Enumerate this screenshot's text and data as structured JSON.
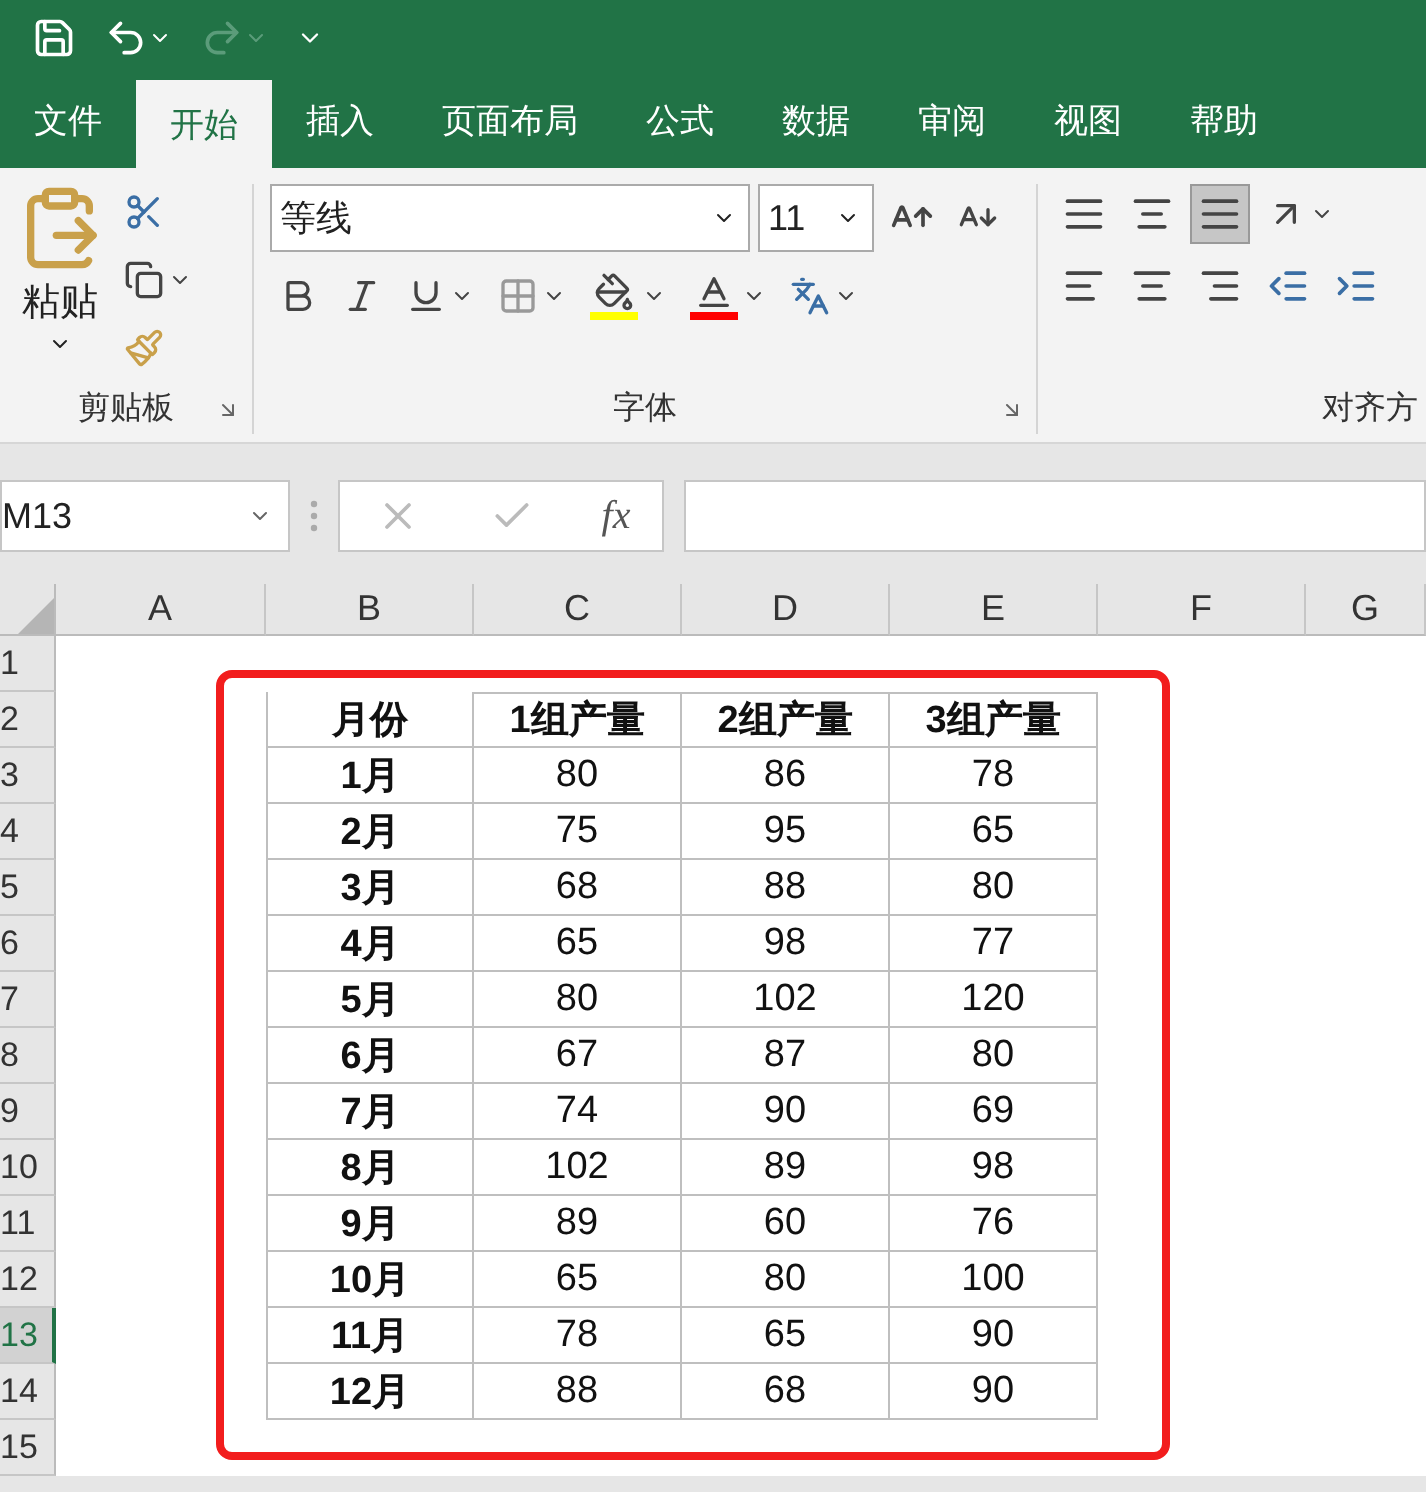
{
  "tabs": [
    {
      "label": "文件",
      "selected": false
    },
    {
      "label": "开始",
      "selected": true
    },
    {
      "label": "插入",
      "selected": false
    },
    {
      "label": "页面布局",
      "selected": false
    },
    {
      "label": "公式",
      "selected": false
    },
    {
      "label": "数据",
      "selected": false
    },
    {
      "label": "审阅",
      "selected": false
    },
    {
      "label": "视图",
      "selected": false
    },
    {
      "label": "帮助",
      "selected": false
    }
  ],
  "ribbon": {
    "paste_label": "粘贴",
    "font_name": "等线",
    "font_size": "11",
    "color_buttons": [
      {
        "kind": "fill",
        "color": "#ffff00"
      },
      {
        "kind": "font",
        "color": "#ff0000"
      }
    ],
    "vertical_align": [
      {
        "selected": false
      },
      {
        "selected": false
      },
      {
        "selected": true
      }
    ],
    "groups": [
      "剪贴板",
      "字体",
      "对齐方"
    ]
  },
  "name_box": "M13",
  "function_button": "fx",
  "sheet": {
    "column_headers": [
      "A",
      "B",
      "C",
      "D",
      "E",
      "F",
      "G"
    ],
    "row_headers": [
      {
        "label": "1",
        "selected": false
      },
      {
        "label": "2",
        "selected": false
      },
      {
        "label": "3",
        "selected": false
      },
      {
        "label": "4",
        "selected": false
      },
      {
        "label": "5",
        "selected": false
      },
      {
        "label": "6",
        "selected": false
      },
      {
        "label": "7",
        "selected": false
      },
      {
        "label": "8",
        "selected": false
      },
      {
        "label": "9",
        "selected": false
      },
      {
        "label": "10",
        "selected": false
      },
      {
        "label": "11",
        "selected": false
      },
      {
        "label": "12",
        "selected": false
      },
      {
        "label": "13",
        "selected": true
      },
      {
        "label": "14",
        "selected": false
      },
      {
        "label": "15",
        "selected": false
      }
    ],
    "table": {
      "columns": [
        "月份",
        "1组产量",
        "2组产量",
        "3组产量"
      ],
      "rows": [
        [
          "1月",
          "80",
          "86",
          "78"
        ],
        [
          "2月",
          "75",
          "95",
          "65"
        ],
        [
          "3月",
          "68",
          "88",
          "80"
        ],
        [
          "4月",
          "65",
          "98",
          "77"
        ],
        [
          "5月",
          "80",
          "102",
          "120"
        ],
        [
          "6月",
          "67",
          "87",
          "80"
        ],
        [
          "7月",
          "74",
          "90",
          "69"
        ],
        [
          "8月",
          "102",
          "89",
          "98"
        ],
        [
          "9月",
          "89",
          "60",
          "76"
        ],
        [
          "10月",
          "65",
          "80",
          "100"
        ],
        [
          "11月",
          "78",
          "65",
          "90"
        ],
        [
          "12月",
          "88",
          "68",
          "90"
        ]
      ]
    }
  }
}
